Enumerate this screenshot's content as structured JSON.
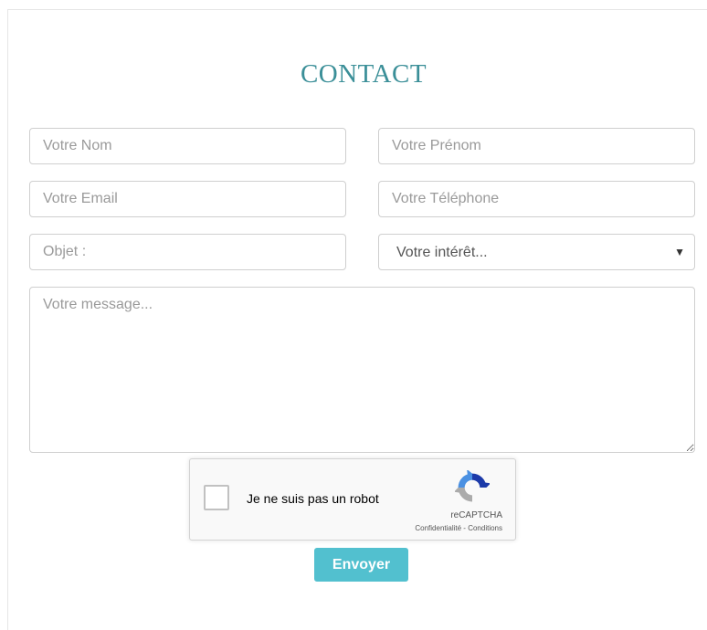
{
  "form": {
    "title": "CONTACT",
    "fields": {
      "last_name": {
        "placeholder": "Votre Nom",
        "value": ""
      },
      "first_name": {
        "placeholder": "Votre Prénom",
        "value": ""
      },
      "email": {
        "placeholder": "Votre Email",
        "value": ""
      },
      "phone": {
        "placeholder": "Votre Téléphone",
        "value": ""
      },
      "subject": {
        "placeholder": "Objet :",
        "value": ""
      },
      "interest": {
        "selected": "Votre intérêt...",
        "arrow": "▼"
      },
      "message": {
        "placeholder": "Votre message...",
        "value": ""
      }
    },
    "recaptcha": {
      "label": "Je ne suis pas un robot",
      "brand": "reCAPTCHA",
      "privacy": "Confidentialité",
      "separator": " - ",
      "terms": "Conditions"
    },
    "submit_label": "Envoyer"
  },
  "colors": {
    "title": "#3b8f98",
    "button": "#52c0cf",
    "border": "#cfcfcf",
    "placeholder": "#9a9a9a"
  }
}
